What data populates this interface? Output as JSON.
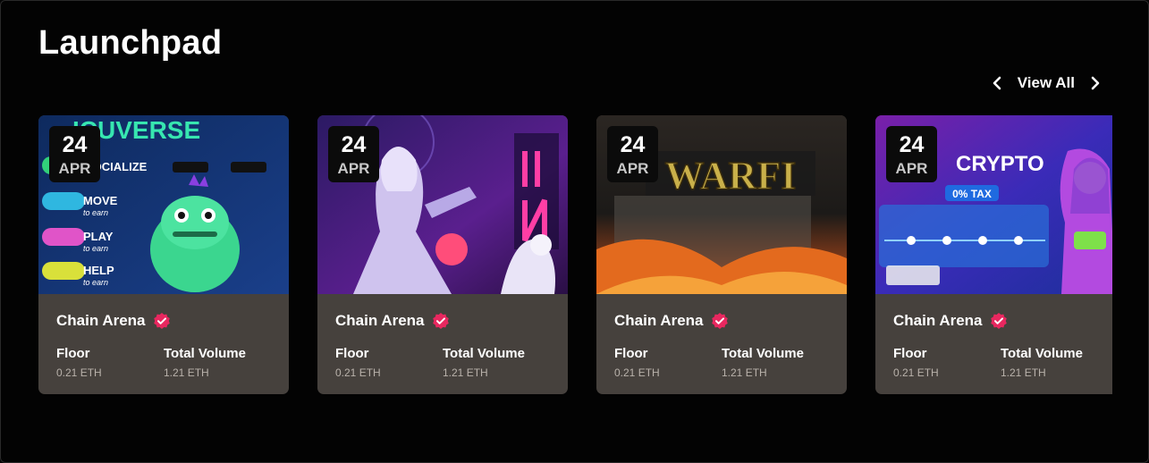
{
  "page": {
    "title": "Launchpad"
  },
  "nav": {
    "view_all_label": "View All",
    "prev_icon": "chevron-left-icon",
    "next_icon": "chevron-right-icon"
  },
  "colors": {
    "card_bg": "#46413d",
    "badge": "#e8275f",
    "date_bg": "#0b0b0b"
  },
  "cards": [
    {
      "day": "24",
      "month": "APR",
      "name": "Chain Arena",
      "verified_icon": "verified-badge-icon",
      "floor_label": "Floor",
      "floor_value": "0.21 ETH",
      "volume_label": "Total Volume",
      "volume_value": "1.21 ETH",
      "image_text": {
        "headline": "ICUVERSE",
        "items": [
          "SOCIALIZE",
          "MOVE",
          "PLAY",
          "HELP"
        ],
        "sub": [
          "to earn",
          "to earn",
          "to earn",
          "to earn"
        ]
      }
    },
    {
      "day": "24",
      "month": "APR",
      "name": "Chain Arena",
      "verified_icon": "verified-badge-icon",
      "floor_label": "Floor",
      "floor_value": "0.21 ETH",
      "volume_label": "Total Volume",
      "volume_value": "1.21 ETH"
    },
    {
      "day": "24",
      "month": "APR",
      "name": "Chain Arena",
      "verified_icon": "verified-badge-icon",
      "floor_label": "Floor",
      "floor_value": "0.21 ETH",
      "volume_label": "Total Volume",
      "volume_value": "1.21 ETH",
      "image_text": {
        "headline": "WARFI"
      }
    },
    {
      "day": "24",
      "month": "APR",
      "name": "Chain Arena",
      "verified_icon": "verified-badge-icon",
      "floor_label": "Floor",
      "floor_value": "0.21 ETH",
      "volume_label": "Total Volume",
      "volume_value": "1.21 ETH",
      "image_text": {
        "headline": "CRYPTO",
        "tag": "0% TAX"
      }
    }
  ]
}
